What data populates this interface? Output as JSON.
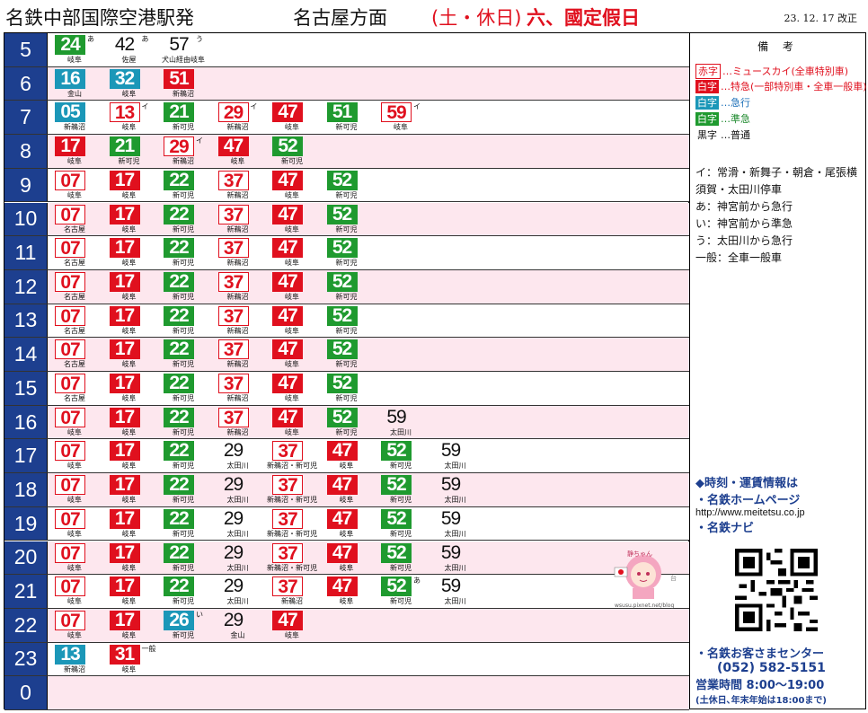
{
  "header": {
    "station": "名鉄中部国際空港駅発",
    "direction": "名古屋方面",
    "days": "(土・休日)",
    "holiday": "六、國定假日",
    "revised": "23. 12. 17  改正"
  },
  "colors": {
    "express_red": "#e0101e",
    "rapid_blue": "#1b97b8",
    "semi_green": "#1f9a2f",
    "hour_navy": "#1d3f8f",
    "row_pink": "#fde7ee"
  },
  "timetable": [
    {
      "hour": "5",
      "bg": "white",
      "trains": [
        {
          "m": "24",
          "type": "semi",
          "mark": "あ",
          "dest": "岐阜"
        },
        {
          "m": "42",
          "type": "loc",
          "mark": "あ",
          "dest": "佐屋"
        },
        {
          "m": "57",
          "type": "loc",
          "mark": "う",
          "dest": "犬山経由岐阜"
        }
      ]
    },
    {
      "hour": "6",
      "bg": "pink",
      "trains": [
        {
          "m": "16",
          "type": "rap",
          "mark": "",
          "dest": "金山"
        },
        {
          "m": "32",
          "type": "rap",
          "mark": "",
          "dest": "岐阜"
        },
        {
          "m": "51",
          "type": "exp",
          "mark": "",
          "dest": "新鵜沼"
        }
      ]
    },
    {
      "hour": "7",
      "bg": "white",
      "trains": [
        {
          "m": "05",
          "type": "rap",
          "mark": "",
          "dest": "新鵜沼"
        },
        {
          "m": "13",
          "type": "lim",
          "mark": "イ",
          "dest": "岐阜"
        },
        {
          "m": "21",
          "type": "semi",
          "mark": "",
          "dest": "新可児"
        },
        {
          "m": "29",
          "type": "lim",
          "mark": "イ",
          "dest": "新鵜沼"
        },
        {
          "m": "47",
          "type": "exp",
          "mark": "",
          "dest": "岐阜"
        },
        {
          "m": "51",
          "type": "semi",
          "mark": "",
          "dest": "新可児"
        },
        {
          "m": "59",
          "type": "lim",
          "mark": "イ",
          "dest": "岐阜"
        }
      ]
    },
    {
      "hour": "8",
      "bg": "pink",
      "trains": [
        {
          "m": "17",
          "type": "exp",
          "mark": "",
          "dest": "岐阜"
        },
        {
          "m": "21",
          "type": "semi",
          "mark": "",
          "dest": "新可児"
        },
        {
          "m": "29",
          "type": "lim",
          "mark": "イ",
          "dest": "新鵜沼"
        },
        {
          "m": "47",
          "type": "exp",
          "mark": "",
          "dest": "岐阜"
        },
        {
          "m": "52",
          "type": "semi",
          "mark": "",
          "dest": "新可児"
        }
      ]
    },
    {
      "hour": "9",
      "bg": "white",
      "trains": [
        {
          "m": "07",
          "type": "lim",
          "mark": "",
          "dest": "岐阜"
        },
        {
          "m": "17",
          "type": "exp",
          "mark": "",
          "dest": "岐阜"
        },
        {
          "m": "22",
          "type": "semi",
          "mark": "",
          "dest": "新可児"
        },
        {
          "m": "37",
          "type": "lim",
          "mark": "",
          "dest": "新鵜沼"
        },
        {
          "m": "47",
          "type": "exp",
          "mark": "",
          "dest": "岐阜"
        },
        {
          "m": "52",
          "type": "semi",
          "mark": "",
          "dest": "新可児"
        }
      ]
    },
    {
      "hour": "10",
      "bg": "pink",
      "trains": [
        {
          "m": "07",
          "type": "lim",
          "mark": "",
          "dest": "名古屋"
        },
        {
          "m": "17",
          "type": "exp",
          "mark": "",
          "dest": "岐阜"
        },
        {
          "m": "22",
          "type": "semi",
          "mark": "",
          "dest": "新可児"
        },
        {
          "m": "37",
          "type": "lim",
          "mark": "",
          "dest": "新鵜沼"
        },
        {
          "m": "47",
          "type": "exp",
          "mark": "",
          "dest": "岐阜"
        },
        {
          "m": "52",
          "type": "semi",
          "mark": "",
          "dest": "新可児"
        }
      ]
    },
    {
      "hour": "11",
      "bg": "white",
      "trains": [
        {
          "m": "07",
          "type": "lim",
          "mark": "",
          "dest": "名古屋"
        },
        {
          "m": "17",
          "type": "exp",
          "mark": "",
          "dest": "岐阜"
        },
        {
          "m": "22",
          "type": "semi",
          "mark": "",
          "dest": "新可児"
        },
        {
          "m": "37",
          "type": "lim",
          "mark": "",
          "dest": "新鵜沼"
        },
        {
          "m": "47",
          "type": "exp",
          "mark": "",
          "dest": "岐阜"
        },
        {
          "m": "52",
          "type": "semi",
          "mark": "",
          "dest": "新可児"
        }
      ]
    },
    {
      "hour": "12",
      "bg": "pink",
      "trains": [
        {
          "m": "07",
          "type": "lim",
          "mark": "",
          "dest": "名古屋"
        },
        {
          "m": "17",
          "type": "exp",
          "mark": "",
          "dest": "岐阜"
        },
        {
          "m": "22",
          "type": "semi",
          "mark": "",
          "dest": "新可児"
        },
        {
          "m": "37",
          "type": "lim",
          "mark": "",
          "dest": "新鵜沼"
        },
        {
          "m": "47",
          "type": "exp",
          "mark": "",
          "dest": "岐阜"
        },
        {
          "m": "52",
          "type": "semi",
          "mark": "",
          "dest": "新可児"
        }
      ]
    },
    {
      "hour": "13",
      "bg": "white",
      "trains": [
        {
          "m": "07",
          "type": "lim",
          "mark": "",
          "dest": "名古屋"
        },
        {
          "m": "17",
          "type": "exp",
          "mark": "",
          "dest": "岐阜"
        },
        {
          "m": "22",
          "type": "semi",
          "mark": "",
          "dest": "新可児"
        },
        {
          "m": "37",
          "type": "lim",
          "mark": "",
          "dest": "新鵜沼"
        },
        {
          "m": "47",
          "type": "exp",
          "mark": "",
          "dest": "岐阜"
        },
        {
          "m": "52",
          "type": "semi",
          "mark": "",
          "dest": "新可児"
        }
      ]
    },
    {
      "hour": "14",
      "bg": "pink",
      "trains": [
        {
          "m": "07",
          "type": "lim",
          "mark": "",
          "dest": "名古屋"
        },
        {
          "m": "17",
          "type": "exp",
          "mark": "",
          "dest": "岐阜"
        },
        {
          "m": "22",
          "type": "semi",
          "mark": "",
          "dest": "新可児"
        },
        {
          "m": "37",
          "type": "lim",
          "mark": "",
          "dest": "新鵜沼"
        },
        {
          "m": "47",
          "type": "exp",
          "mark": "",
          "dest": "岐阜"
        },
        {
          "m": "52",
          "type": "semi",
          "mark": "",
          "dest": "新可児"
        }
      ]
    },
    {
      "hour": "15",
      "bg": "white",
      "trains": [
        {
          "m": "07",
          "type": "lim",
          "mark": "",
          "dest": "名古屋"
        },
        {
          "m": "17",
          "type": "exp",
          "mark": "",
          "dest": "岐阜"
        },
        {
          "m": "22",
          "type": "semi",
          "mark": "",
          "dest": "新可児"
        },
        {
          "m": "37",
          "type": "lim",
          "mark": "",
          "dest": "新鵜沼"
        },
        {
          "m": "47",
          "type": "exp",
          "mark": "",
          "dest": "岐阜"
        },
        {
          "m": "52",
          "type": "semi",
          "mark": "",
          "dest": "新可児"
        }
      ]
    },
    {
      "hour": "16",
      "bg": "pink",
      "trains": [
        {
          "m": "07",
          "type": "lim",
          "mark": "",
          "dest": "岐阜"
        },
        {
          "m": "17",
          "type": "exp",
          "mark": "",
          "dest": "岐阜"
        },
        {
          "m": "22",
          "type": "semi",
          "mark": "",
          "dest": "新可児"
        },
        {
          "m": "37",
          "type": "lim",
          "mark": "",
          "dest": "新鵜沼"
        },
        {
          "m": "47",
          "type": "exp",
          "mark": "",
          "dest": "岐阜"
        },
        {
          "m": "52",
          "type": "semi",
          "mark": "",
          "dest": "新可児"
        },
        {
          "m": "59",
          "type": "loc",
          "mark": "",
          "dest": "太田川"
        }
      ]
    },
    {
      "hour": "17",
      "bg": "white",
      "trains": [
        {
          "m": "07",
          "type": "lim",
          "mark": "",
          "dest": "岐阜"
        },
        {
          "m": "17",
          "type": "exp",
          "mark": "",
          "dest": "岐阜"
        },
        {
          "m": "22",
          "type": "semi",
          "mark": "",
          "dest": "新可児"
        },
        {
          "m": "29",
          "type": "loc",
          "mark": "",
          "dest": "太田川"
        },
        {
          "m": "37",
          "type": "lim",
          "mark": "",
          "dest": "新鵜沼・新可児"
        },
        {
          "m": "47",
          "type": "exp",
          "mark": "",
          "dest": "岐阜"
        },
        {
          "m": "52",
          "type": "semi",
          "mark": "",
          "dest": "新可児"
        },
        {
          "m": "59",
          "type": "loc",
          "mark": "",
          "dest": "太田川"
        }
      ]
    },
    {
      "hour": "18",
      "bg": "pink",
      "trains": [
        {
          "m": "07",
          "type": "lim",
          "mark": "",
          "dest": "岐阜"
        },
        {
          "m": "17",
          "type": "exp",
          "mark": "",
          "dest": "岐阜"
        },
        {
          "m": "22",
          "type": "semi",
          "mark": "",
          "dest": "新可児"
        },
        {
          "m": "29",
          "type": "loc",
          "mark": "",
          "dest": "太田川"
        },
        {
          "m": "37",
          "type": "lim",
          "mark": "",
          "dest": "新鵜沼・新可児"
        },
        {
          "m": "47",
          "type": "exp",
          "mark": "",
          "dest": "岐阜"
        },
        {
          "m": "52",
          "type": "semi",
          "mark": "",
          "dest": "新可児"
        },
        {
          "m": "59",
          "type": "loc",
          "mark": "",
          "dest": "太田川"
        }
      ]
    },
    {
      "hour": "19",
      "bg": "white",
      "trains": [
        {
          "m": "07",
          "type": "lim",
          "mark": "",
          "dest": "岐阜"
        },
        {
          "m": "17",
          "type": "exp",
          "mark": "",
          "dest": "岐阜"
        },
        {
          "m": "22",
          "type": "semi",
          "mark": "",
          "dest": "新可児"
        },
        {
          "m": "29",
          "type": "loc",
          "mark": "",
          "dest": "太田川"
        },
        {
          "m": "37",
          "type": "lim",
          "mark": "",
          "dest": "新鵜沼・新可児"
        },
        {
          "m": "47",
          "type": "exp",
          "mark": "",
          "dest": "岐阜"
        },
        {
          "m": "52",
          "type": "semi",
          "mark": "",
          "dest": "新可児"
        },
        {
          "m": "59",
          "type": "loc",
          "mark": "",
          "dest": "太田川"
        }
      ]
    },
    {
      "hour": "20",
      "bg": "pink",
      "trains": [
        {
          "m": "07",
          "type": "lim",
          "mark": "",
          "dest": "岐阜"
        },
        {
          "m": "17",
          "type": "exp",
          "mark": "",
          "dest": "岐阜"
        },
        {
          "m": "22",
          "type": "semi",
          "mark": "",
          "dest": "新可児"
        },
        {
          "m": "29",
          "type": "loc",
          "mark": "",
          "dest": "太田川"
        },
        {
          "m": "37",
          "type": "lim",
          "mark": "",
          "dest": "新鵜沼・新可児"
        },
        {
          "m": "47",
          "type": "exp",
          "mark": "",
          "dest": "岐阜"
        },
        {
          "m": "52",
          "type": "semi",
          "mark": "",
          "dest": "新可児"
        },
        {
          "m": "59",
          "type": "loc",
          "mark": "",
          "dest": "太田川"
        }
      ]
    },
    {
      "hour": "21",
      "bg": "white",
      "trains": [
        {
          "m": "07",
          "type": "lim",
          "mark": "",
          "dest": "岐阜"
        },
        {
          "m": "17",
          "type": "exp",
          "mark": "",
          "dest": "岐阜"
        },
        {
          "m": "22",
          "type": "semi",
          "mark": "",
          "dest": "新可児"
        },
        {
          "m": "29",
          "type": "loc",
          "mark": "",
          "dest": "太田川"
        },
        {
          "m": "37",
          "type": "lim",
          "mark": "",
          "dest": "新鵜沼"
        },
        {
          "m": "47",
          "type": "exp",
          "mark": "",
          "dest": "岐阜"
        },
        {
          "m": "52",
          "type": "semi",
          "mark": "あ",
          "dest": "新可児"
        },
        {
          "m": "59",
          "type": "loc",
          "mark": "",
          "dest": "太田川"
        }
      ]
    },
    {
      "hour": "22",
      "bg": "pink",
      "trains": [
        {
          "m": "07",
          "type": "lim",
          "mark": "",
          "dest": "岐阜"
        },
        {
          "m": "17",
          "type": "exp",
          "mark": "",
          "dest": "岐阜"
        },
        {
          "m": "26",
          "type": "rap",
          "mark": "い",
          "dest": "新可児"
        },
        {
          "m": "29",
          "type": "loc",
          "mark": "",
          "dest": "金山"
        },
        {
          "m": "47",
          "type": "exp",
          "mark": "",
          "dest": "岐阜"
        }
      ]
    },
    {
      "hour": "23",
      "bg": "white",
      "trains": [
        {
          "m": "13",
          "type": "rap",
          "mark": "",
          "dest": "新鵜沼"
        },
        {
          "m": "31",
          "type": "exp",
          "mark": "一般",
          "dest": "岐阜"
        }
      ]
    },
    {
      "hour": "0",
      "bg": "pink",
      "trains": []
    }
  ],
  "notes": {
    "title": "備 考",
    "legend": [
      {
        "swatch": "赤字",
        "style": "limited",
        "text": "…ミュースカイ(全車特別車)",
        "tclass": "txt-red"
      },
      {
        "swatch": "白字",
        "style": "express",
        "text": "…特急(一部特別車・全車一般車)",
        "tclass": "txt-red"
      },
      {
        "swatch": "白字",
        "style": "rapid",
        "text": "…急行",
        "tclass": "txt-blue"
      },
      {
        "swatch": "白字",
        "style": "semi",
        "text": "…準急",
        "tclass": "txt-green"
      },
      {
        "swatch": "黒字",
        "style": "local",
        "text": "…普通",
        "tclass": ""
      }
    ],
    "marks": [
      "イ：常滑・新舞子・朝倉・尾張横須賀・太田川停車",
      "あ：神宮前から急行",
      "い：神宮前から準急",
      "う：太田川から急行",
      "一般：全車一般車"
    ]
  },
  "info": {
    "heading": "◆時刻・運賃情報は",
    "line1": "・名鉄ホームページ",
    "url": "http://www.meitetsu.co.jp",
    "line2": "・名鉄ナビ"
  },
  "center": {
    "title": "・名鉄お客さまセンター",
    "tel": "(052) 582-5151",
    "hours": "営業時間  8:00〜19:00",
    "note": "(土休日､年末年始は18:00まで)"
  }
}
